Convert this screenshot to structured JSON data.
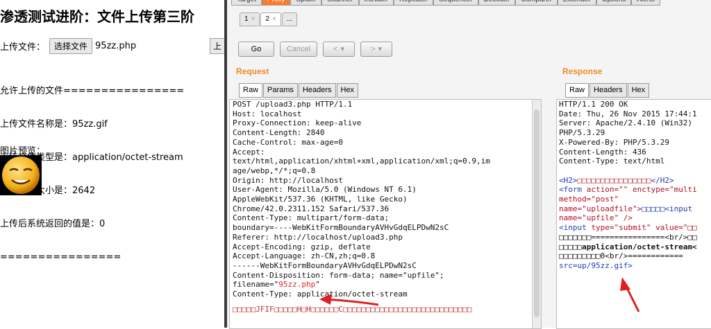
{
  "browser": {
    "title": "渗透测试进阶：文件上传第三阶",
    "upload_label": "上传文件：",
    "choose_button": "选择文件",
    "chosen_file": "95zz.php",
    "upload_button_fragment": "上",
    "info_lines": [
      "允许上传的文件================",
      "上传文件名称是：95zz.gif",
      "上传文件类型是：application/octet-stream",
      "上传文件大小是：2642",
      "上传后系统返回的值是：0",
      "================"
    ],
    "preview_label": "图片预览："
  },
  "burp": {
    "top_tabs": [
      "Target",
      "Proxy",
      "Spider",
      "Scanner",
      "Intruder",
      "Repeater",
      "Sequencer",
      "Decoder",
      "Comparer",
      "Extender",
      "Options",
      "Alerts"
    ],
    "repeater_tabs": [
      {
        "label": "1",
        "close": "×"
      },
      {
        "label": "2",
        "close": "×"
      },
      {
        "label": "...",
        "close": ""
      }
    ],
    "buttons": {
      "go": "Go",
      "cancel": "Cancel",
      "back": "<",
      "back_menu": "▾",
      "fwd": ">",
      "fwd_menu": "▾"
    },
    "request": {
      "heading": "Request",
      "tabs": [
        "Raw",
        "Params",
        "Headers",
        "Hex"
      ],
      "lines": [
        "POST /upload3.php HTTP/1.1",
        "Host: localhost",
        "Proxy-Connection: keep-alive",
        "Content-Length: 2840",
        "Cache-Control: max-age=0",
        "Accept:",
        "text/html,application/xhtml+xml,application/xml;q=0.9,im",
        "age/webp,*/*;q=0.8",
        "Origin: http://localhost",
        "User-Agent: Mozilla/5.0 (Windows NT 6.1)",
        "AppleWebKit/537.36 (KHTML, like Gecko)",
        "Chrome/42.0.2311.152 Safari/537.36",
        "Content-Type: multipart/form-data;",
        "boundary=----WebKitFormBoundaryAVHvGdqELPDwN2sC",
        "Referer: http://localhost/upload3.php",
        "Accept-Encoding: gzip, deflate",
        "Accept-Language: zh-CN,zh;q=0.8",
        "",
        "------WebKitFormBoundaryAVHvGdqELPDwN2sC",
        "Content-Disposition: form-data; name=\"upfile\";"
      ],
      "filename_prefix": "filename=\"",
      "filename_value": "95zz.php",
      "filename_suffix": "\"",
      "content_type_line": "Content-Type: application/octet-stream",
      "garbage_line": "□□□□□JFIF□□□□□H□H□□□□□□C□□□□□□□□□□□□□□□□□□□□□□□□□□□□"
    },
    "response": {
      "heading": "Response",
      "tabs": [
        "Raw",
        "Headers",
        "Hex"
      ],
      "lines": [
        "HTTP/1.1 200 OK",
        "Date: Thu, 26 Nov 2015 17:44:1",
        "Server: Apache/2.4.10 (Win32)",
        "PHP/5.3.29",
        "X-Powered-By: PHP/5.3.29",
        "Content-Length: 436",
        "Content-Type: text/html"
      ],
      "html_lines": [
        {
          "a": "<H2>",
          "b": "□□□□□□□□□□□□□□□□",
          "c": "</H2>"
        },
        {
          "a": "<form ",
          "b": "action=\"\" enctype=\"multi",
          "c": ""
        },
        {
          "a": "",
          "b": "method=\"post\"",
          "c": ""
        },
        {
          "a": "",
          "b": "name=\"uploadfile\">",
          "c": "□□□□□<input"
        },
        {
          "a": "",
          "b": "name=\"upfile\" />",
          "c": ""
        },
        {
          "a": "<input ",
          "b": "type=\"submit\" value=\"□□",
          "c": ""
        },
        {
          "a": "",
          "b": "",
          "c": "□□□□□□□================<br/>□□"
        },
        {
          "a": "",
          "b": "",
          "c": "□□□□□application/octet-stream<"
        },
        {
          "a": "",
          "b": "",
          "c": "□□□□□□□□□0<br/>============"
        },
        {
          "a": "",
          "b": "src=up/95zz.gif",
          "c": ">"
        }
      ]
    }
  },
  "colors": {
    "accent": "#f08a24",
    "active_tab": "#ff7a2a",
    "arrow": "#e02020"
  }
}
